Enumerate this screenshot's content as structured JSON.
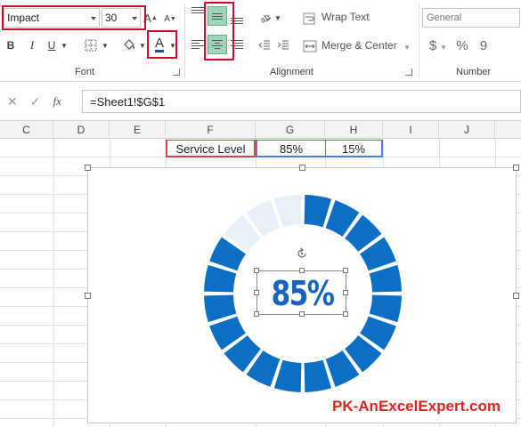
{
  "ribbon": {
    "font": {
      "name": "Impact",
      "size": "30",
      "grow_glyph": "A",
      "shrink_glyph": "A",
      "bold_glyph": "B",
      "italic_glyph": "I",
      "underline_glyph": "U",
      "font_color_glyph": "A",
      "group_label": "Font"
    },
    "alignment": {
      "wrap_text": "Wrap Text",
      "merge_center": "Merge & Center",
      "group_label": "Alignment"
    },
    "number": {
      "format": "General",
      "currency_glyph": "$",
      "percent_glyph": "%",
      "comma_glyph": "9",
      "group_label": "Number"
    },
    "accent": "#c8102e",
    "active_fill": "#9fd5b7"
  },
  "formula_bar": {
    "fx_label": "fx",
    "formula": "=Sheet1!$G$1"
  },
  "columns": [
    "C",
    "D",
    "E",
    "F",
    "G",
    "H",
    "I",
    "J"
  ],
  "cells": {
    "f1": "Service Level",
    "g1": "85%",
    "h1": "15%"
  },
  "chart": {
    "label": "85%",
    "filled_color": "#0b6fc4",
    "empty_color": "#e8f0f8",
    "segments": 20,
    "filled_fraction": 0.85
  },
  "watermark": "PK-AnExcelExpert.com"
}
